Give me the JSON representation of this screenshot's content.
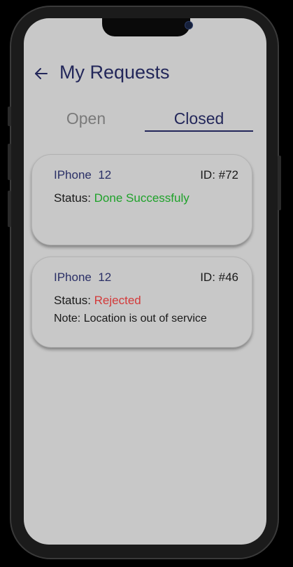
{
  "header": {
    "title": "My Requests",
    "back_icon": "arrow-left-icon"
  },
  "tabs": [
    {
      "label": "Open",
      "active": false
    },
    {
      "label": "Closed",
      "active": true
    }
  ],
  "requests": [
    {
      "device": "IPhone  12",
      "id_label": "ID: #72",
      "status_label": "Status:",
      "status_value": "Done Successfuly",
      "status_color": "#1fa22a",
      "note": ""
    },
    {
      "device": "IPhone  12",
      "id_label": "ID: #46",
      "status_label": "Status:",
      "status_value": "Rejected",
      "status_color": "#d33a3a",
      "note": "Note: Location is out of service"
    }
  ],
  "colors": {
    "primary": "#23275a",
    "screen_bg": "#c8c8c8",
    "inactive_tab": "#7a7a7a"
  }
}
